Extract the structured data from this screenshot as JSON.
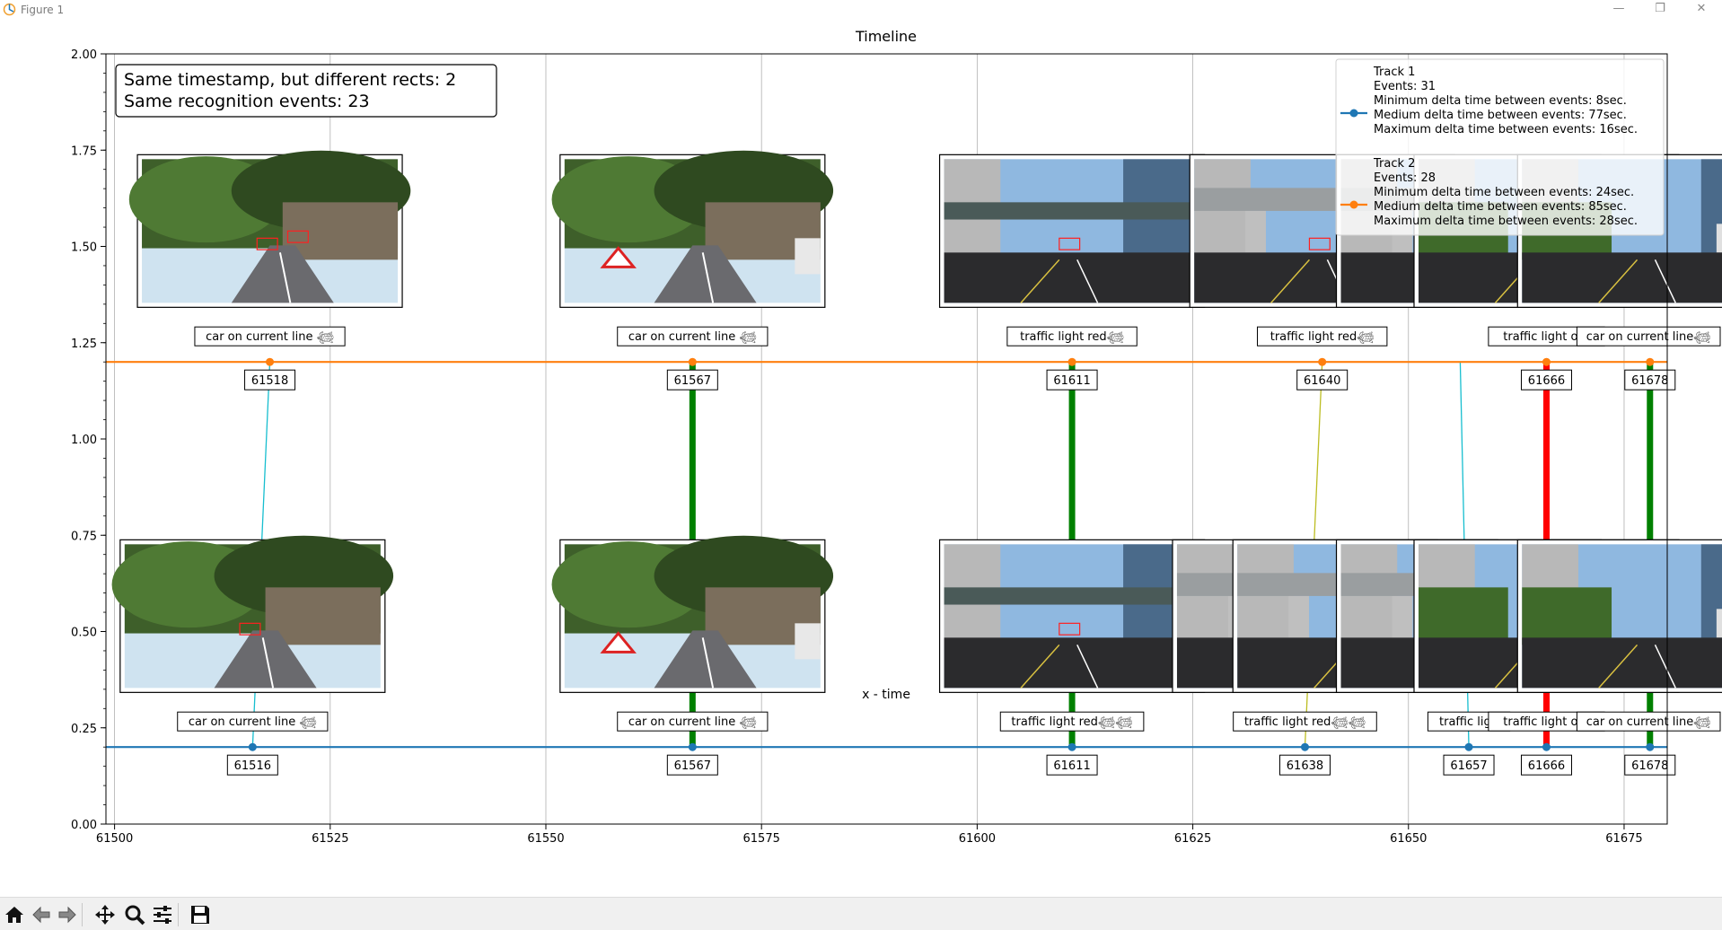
{
  "window": {
    "title": "Figure 1",
    "minimize_icon": "minimize-icon",
    "maximize_icon": "restore-icon",
    "close_icon": "close-icon"
  },
  "toolbar": {
    "buttons": [
      {
        "name": "home-button",
        "icon": "home-icon"
      },
      {
        "name": "back-button",
        "icon": "arrow-left-icon"
      },
      {
        "name": "forward-button",
        "icon": "arrow-right-icon"
      },
      {
        "name": "pan-button",
        "icon": "move-icon"
      },
      {
        "name": "zoom-button",
        "icon": "magnifier-icon"
      },
      {
        "name": "subplots-button",
        "icon": "sliders-icon"
      },
      {
        "name": "save-button",
        "icon": "floppy-disk-icon"
      }
    ]
  },
  "chart_data": {
    "type": "line",
    "title": "Timeline",
    "xlabel": "x - time",
    "ylabel": "",
    "xlim": [
      61499,
      61680
    ],
    "ylim": [
      0,
      2
    ],
    "xticks": [
      61500,
      61525,
      61550,
      61575,
      61600,
      61625,
      61650,
      61675
    ],
    "yticks": [
      0.0,
      0.25,
      0.5,
      0.75,
      1.0,
      1.25,
      1.5,
      1.75,
      2.0
    ],
    "ytick_labels": [
      "0.00",
      "0.25",
      "0.50",
      "0.75",
      "1.00",
      "1.25",
      "1.50",
      "1.75",
      "2.00"
    ],
    "grid": "vertical",
    "stats_box": {
      "line1": "Same timestamp, but different rects: 2",
      "line2": "Same recognition events: 23",
      "placement": "top-left"
    },
    "legend": {
      "placement": "top-right",
      "entries": [
        {
          "color": "#1f77b4",
          "lines": [
            "Track 1",
            "Events: 31",
            "Minimum delta time between events: 8sec.",
            "Medium delta time between events: 77sec.",
            "Maximum delta time between events: 16sec."
          ]
        },
        {
          "color": "#ff7f0e",
          "lines": [
            "Track 2",
            "Events: 28",
            "Minimum delta time between events: 24sec.",
            "Medium delta time between events: 85sec.",
            "Maximum delta time between events: 28sec."
          ]
        }
      ]
    },
    "series": [
      {
        "name": "Track 1",
        "color": "#1f77b4",
        "y": 0.2,
        "events": [
          {
            "x": 61516,
            "id": "61516",
            "label": "car on current line 𓆉"
          },
          {
            "x": 61567,
            "id": "61567",
            "label": "car on current line 𓆉"
          },
          {
            "x": 61611,
            "id": "61611",
            "label": "traffic light red𓆉𓆉"
          },
          {
            "x": 61638,
            "id": "61638",
            "label": "traffic light red𓆉𓆉"
          },
          {
            "x": 61657,
            "id": "61657",
            "label": "traffic ligh"
          },
          {
            "x": 61666,
            "id": "61666",
            "label": "traffic light ora"
          },
          {
            "x": 61678,
            "id": "61678",
            "label": "car on current line𓆉"
          }
        ]
      },
      {
        "name": "Track 2",
        "color": "#ff7f0e",
        "y": 1.2,
        "events": [
          {
            "x": 61518,
            "id": "61518",
            "label": "car on current line 𓆉"
          },
          {
            "x": 61567,
            "id": "61567",
            "label": "car on current line 𓆉"
          },
          {
            "x": 61611,
            "id": "61611",
            "label": "traffic light red𓆉"
          },
          {
            "x": 61640,
            "id": "61640",
            "label": "traffic light red𓆉"
          },
          {
            "x": 61666,
            "id": "61666",
            "label": "traffic light ora"
          },
          {
            "x": 61678,
            "id": "61678",
            "label": "car on current line𓆉"
          }
        ]
      }
    ],
    "connections": [
      {
        "x1": 61516,
        "x2": 61518,
        "color": "#17becf",
        "kind": "thin"
      },
      {
        "x1": 61567,
        "x2": 61567,
        "color": "#008000",
        "kind": "thick"
      },
      {
        "x1": 61611,
        "x2": 61611,
        "color": "#008000",
        "kind": "thick"
      },
      {
        "x1": 61638,
        "x2": 61640,
        "color": "#bcbd22",
        "kind": "thin"
      },
      {
        "x1": 61657,
        "x2": 61656,
        "color": "#17becf",
        "kind": "thin"
      },
      {
        "x1": 61666,
        "x2": 61666,
        "color": "#ff0000",
        "kind": "thick"
      },
      {
        "x1": 61678,
        "x2": 61678,
        "color": "#008000",
        "kind": "thick"
      }
    ],
    "thumbnails": [
      {
        "track": 2,
        "x": 61518,
        "scene": "forest-road",
        "rects": 2
      },
      {
        "track": 2,
        "x": 61567,
        "scene": "forest-road-sign",
        "rects": 0
      },
      {
        "track": 2,
        "x": 61611,
        "scene": "city-bridge",
        "rects": 1
      },
      {
        "track": 2,
        "x": 61640,
        "scene": "city-walkway",
        "rects": 2
      },
      {
        "track": 2,
        "x": 61657,
        "scene": "city-walkway",
        "rects": 1
      },
      {
        "track": 2,
        "x": 61666,
        "scene": "city-street",
        "rects": 0
      },
      {
        "track": 2,
        "x": 61678,
        "scene": "city-street",
        "rects": 0
      },
      {
        "track": 1,
        "x": 61516,
        "scene": "forest-road",
        "rects": 1
      },
      {
        "track": 1,
        "x": 61567,
        "scene": "forest-road-sign",
        "rects": 0
      },
      {
        "track": 1,
        "x": 61611,
        "scene": "city-bridge",
        "rects": 1
      },
      {
        "track": 1,
        "x": 61638,
        "scene": "city-walkway",
        "rects": 0
      },
      {
        "track": 1,
        "x": 61645,
        "scene": "city-walkway",
        "rects": 0
      },
      {
        "track": 1,
        "x": 61657,
        "scene": "city-walkway",
        "rects": 0
      },
      {
        "track": 1,
        "x": 61666,
        "scene": "city-street",
        "rects": 0
      },
      {
        "track": 1,
        "x": 61678,
        "scene": "city-street",
        "rects": 0
      }
    ]
  }
}
